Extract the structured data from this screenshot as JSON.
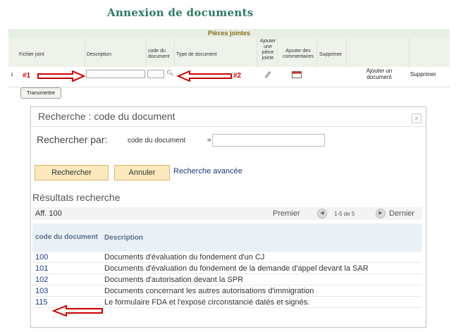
{
  "top": {
    "title": "Annexion de documents",
    "section_title": "Pièces jointes",
    "columns": {
      "fichier": "Fichier joint",
      "description": "Description",
      "code": "code du document",
      "type": "Type de document",
      "ajouter_piece": "Ajouter une pièce jointe",
      "ajouter_comm": "Ajouter des commentaires",
      "supprimer": "Supprimer"
    },
    "row": {
      "num": "1",
      "marker1": "#1",
      "marker2": "#2",
      "ajouter_document": "Ajouter un document",
      "supprimer": "Supprimer"
    },
    "transmit_label": "Transmettre"
  },
  "dialog": {
    "title": "Recherche : code du document",
    "close": "×",
    "search_by": "Rechercher par:",
    "field_label": "code du document",
    "operator": "=",
    "search_value": "",
    "btn_search": "Rechercher",
    "btn_cancel": "Annuler",
    "advanced": "Recherche avancée",
    "results_title": "Résultats recherche",
    "display": "Aff. 100",
    "pager": {
      "first": "Premier",
      "count": "1-5 de 5",
      "last": "Dernier"
    },
    "table": {
      "headers": [
        "code du document",
        "Description"
      ],
      "rows": [
        {
          "code": "100",
          "desc": "Documents d'évaluation du fondement d'un CJ"
        },
        {
          "code": "101",
          "desc": "Documents d'évaluation du fondement de la demande d'appel devant la SAR"
        },
        {
          "code": "102",
          "desc": "Documents d'autorisation devant la SPR"
        },
        {
          "code": "103",
          "desc": "Documents concernant les autres autorisations d'immigration"
        },
        {
          "code": "115",
          "desc": "Le formulaire FDA et l'exposé circonstancié datés et signés."
        }
      ]
    }
  },
  "colors": {
    "title_green": "#2e7a66",
    "annotation_red": "#d00000",
    "button_orange": "#fbe8bd"
  },
  "icons": [
    "search-icon",
    "paperclip-icon",
    "comment-icon",
    "close-icon",
    "prev-page-icon",
    "next-page-icon",
    "red-arrow-icon"
  ]
}
